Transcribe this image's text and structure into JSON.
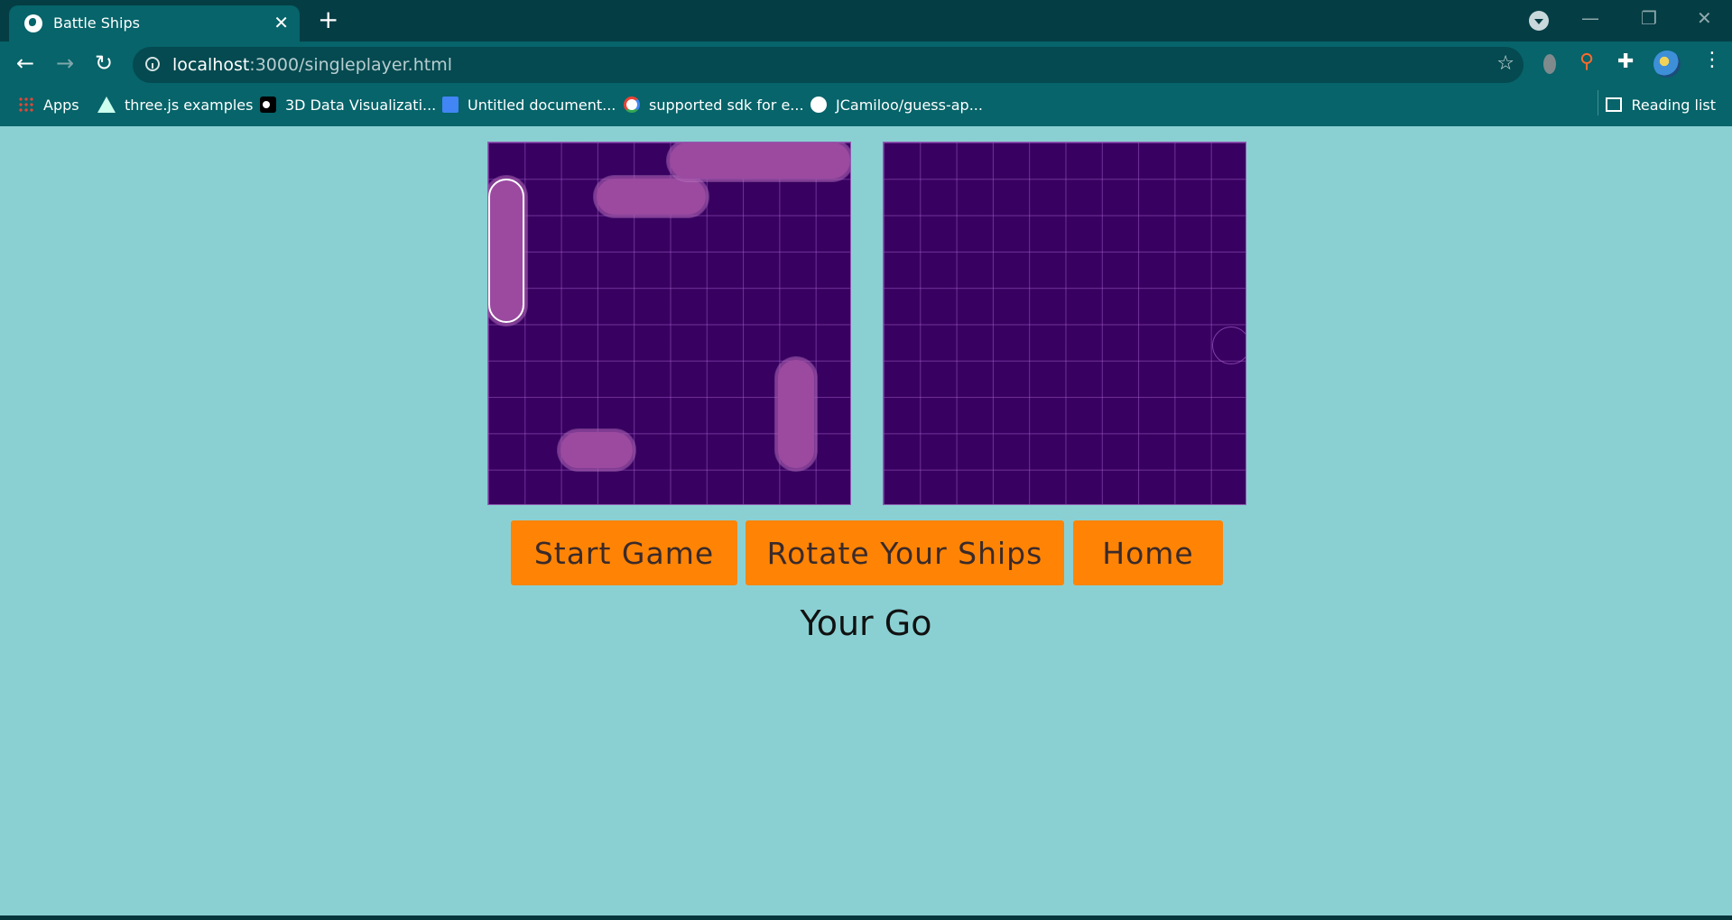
{
  "browser": {
    "tab_title": "Battle Ships",
    "url_host": "localhost",
    "url_path": ":3000/singleplayer.html",
    "bookmarks": [
      {
        "label": "Apps",
        "icon": "apps-grid-icon"
      },
      {
        "label": "three.js examples",
        "icon": "threejs-icon"
      },
      {
        "label": "3D Data Visualizati...",
        "icon": "medium-icon"
      },
      {
        "label": "Untitled document...",
        "icon": "google-docs-icon"
      },
      {
        "label": "supported sdk for e...",
        "icon": "google-icon"
      },
      {
        "label": "JCamiloo/guess-ap...",
        "icon": "github-icon"
      }
    ],
    "reading_list": "Reading list"
  },
  "game": {
    "grid_size": 10,
    "user_ships": [
      {
        "name": "destroyer",
        "start": [
          2,
          8
        ],
        "length": 2,
        "orientation": "horizontal"
      },
      {
        "name": "submarine",
        "start": [
          3,
          1
        ],
        "length": 3,
        "orientation": "horizontal"
      },
      {
        "name": "cruiser",
        "start": [
          8,
          6
        ],
        "length": 3,
        "orientation": "vertical"
      },
      {
        "name": "battleship",
        "start": [
          0,
          1
        ],
        "length": 4,
        "orientation": "vertical",
        "selected": true
      },
      {
        "name": "carrier",
        "start": [
          5,
          0
        ],
        "length": 5,
        "orientation": "horizontal"
      }
    ]
  },
  "buttons": {
    "start": "Start Game",
    "rotate": "Rotate Your Ships",
    "home": "Home"
  },
  "status": "Your Go"
}
